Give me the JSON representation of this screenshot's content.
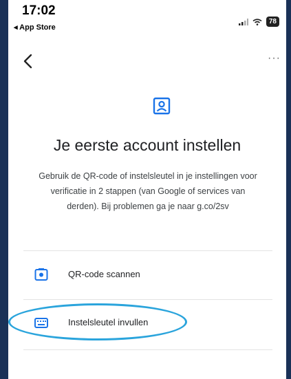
{
  "status_bar": {
    "time": "17:02",
    "back_to_app": "◂ App Store",
    "battery": "78"
  },
  "nav": {
    "back_icon": "chevron-left-icon",
    "more_label": "···"
  },
  "main": {
    "icon": "account-box-icon",
    "title": "Je eerste account instellen",
    "description": "Gebruik de QR-code of instelsleutel in je instellingen voor verificatie in 2 stappen (van Google of services van derden). Bij problemen ga je naar g.co/2sv"
  },
  "options": [
    {
      "icon": "camera-icon",
      "label": "QR-code scannen"
    },
    {
      "icon": "keyboard-icon",
      "label": "Instelsleutel invullen"
    }
  ],
  "colors": {
    "background": "#1a3157",
    "accent_icon": "#1a73e8",
    "highlight": "#2aa4dc"
  }
}
